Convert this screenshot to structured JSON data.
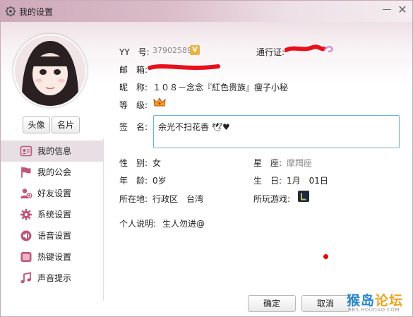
{
  "window": {
    "title": "我的设置",
    "minimize_icon": "minimize-icon",
    "close_icon": "close-icon"
  },
  "profile": {
    "avatar_button": "头像",
    "card_button": "名片"
  },
  "sidebar": {
    "items": [
      {
        "label": "我的信息",
        "icon": "profile-card-icon",
        "active": true
      },
      {
        "label": "我的公会",
        "icon": "flag-icon",
        "active": false
      },
      {
        "label": "好友设置",
        "icon": "friend-icon",
        "active": false
      },
      {
        "label": "系统设置",
        "icon": "gear-icon",
        "active": false
      },
      {
        "label": "语音设置",
        "icon": "speaker-icon",
        "active": false
      },
      {
        "label": "热键设置",
        "icon": "hotkey-icon",
        "active": false
      },
      {
        "label": "声音提示",
        "icon": "music-note-icon",
        "active": false
      }
    ]
  },
  "info": {
    "yy_label": "YY　号:",
    "yy_value": "37902589",
    "yy_badge": "V",
    "passport_label": "通行证:",
    "email_label": "邮　箱:",
    "nickname_label": "昵　称:",
    "nickname_value": "１０８－念念『紅色贵族』瘦子小秘",
    "level_label": "等　级:",
    "level_icon": "crown-icon",
    "sign_label": "签　名:",
    "sign_value": "余光不扫花香 🕊♥",
    "gender_label": "性　别:",
    "gender_value": "女",
    "zodiac_label": "星　座:",
    "zodiac_value": "摩羯座",
    "age_label": "年　龄:",
    "age_value": "0岁",
    "birthday_label": "生　日:",
    "birthday_value": "1月　01日",
    "location_label": "所在地:",
    "location_value": "行政区　台湾",
    "games_label": "所玩游戏:",
    "games_icon": "game-L-icon",
    "bio_label": "个人说明:",
    "bio_value": "生人勿进@"
  },
  "footer": {
    "ok_label": "确定",
    "cancel_label": "取消"
  },
  "watermark": {
    "main_a": "猴岛",
    "main_b": "论坛",
    "sub": "BBS.HOUDAO.COM"
  },
  "colors": {
    "accent_border": "#6cb0e0",
    "active_nav": "#e7dfe3",
    "nav_icon": "#c0557a",
    "redaction": "#e8101c"
  }
}
